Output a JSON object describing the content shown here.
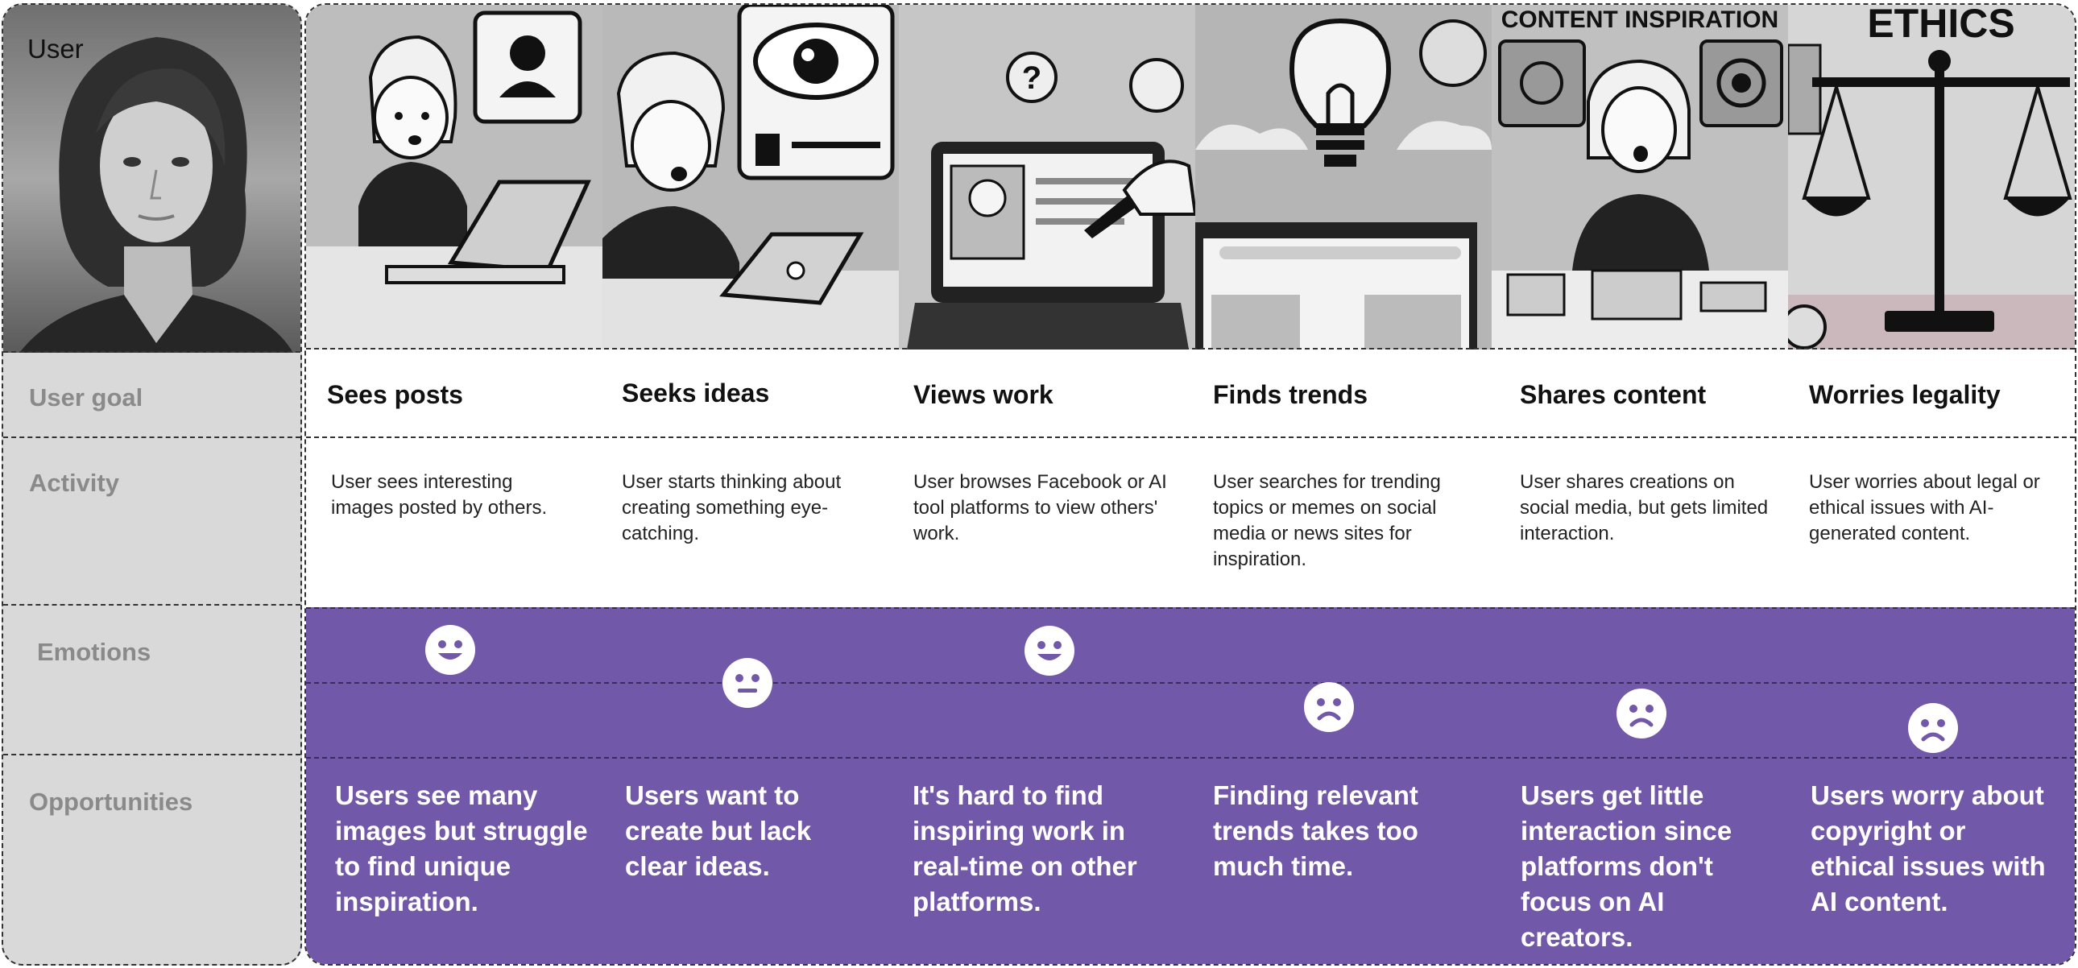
{
  "rows": {
    "user": "User",
    "goal": "User goal",
    "activity": "Activity",
    "emotions": "Emotions",
    "opportunities": "Opportunities"
  },
  "stages": [
    {
      "goal": "Sees posts",
      "activity": "User sees interesting images posted by others.",
      "emotion": "happy",
      "emotion_icon": "smile-face-icon",
      "opportunity": "Users see many images but struggle to find unique inspiration."
    },
    {
      "goal": "Seeks ideas",
      "activity": "User starts thinking about creating something eye-catching.",
      "emotion": "neutral",
      "emotion_icon": "neutral-face-icon",
      "opportunity": "Users want to create but lack clear ideas."
    },
    {
      "goal": "Views work",
      "activity": "User browses Facebook or AI tool platforms to view others' work.",
      "emotion": "happy",
      "emotion_icon": "smile-face-icon",
      "opportunity": "It's hard to find inspiring work in real-time on other platforms."
    },
    {
      "goal": "Finds trends",
      "activity": "User searches for trending topics or memes on social media or news sites for inspiration.",
      "emotion": "sad",
      "emotion_icon": "sad-face-icon",
      "opportunity": "Finding relevant trends takes too much time."
    },
    {
      "goal": "Shares content",
      "activity": "User shares creations on social media, but gets limited interaction.",
      "emotion": "sad",
      "emotion_icon": "sad-face-icon",
      "opportunity": "Users get little interaction since platforms don't focus on AI creators."
    },
    {
      "goal": "Worries legality",
      "activity": "User worries about legal or ethical issues with AI-generated content.",
      "emotion": "sad",
      "emotion_icon": "sad-face-icon",
      "opportunity": "Users worry about copyright or ethical issues with AI content."
    }
  ],
  "illustration_texts": [
    "CONTENT INSPIRATION",
    "ETHICS"
  ],
  "colors": {
    "emotion_band": "#7158a8",
    "label_column": "#d9d9d9"
  }
}
